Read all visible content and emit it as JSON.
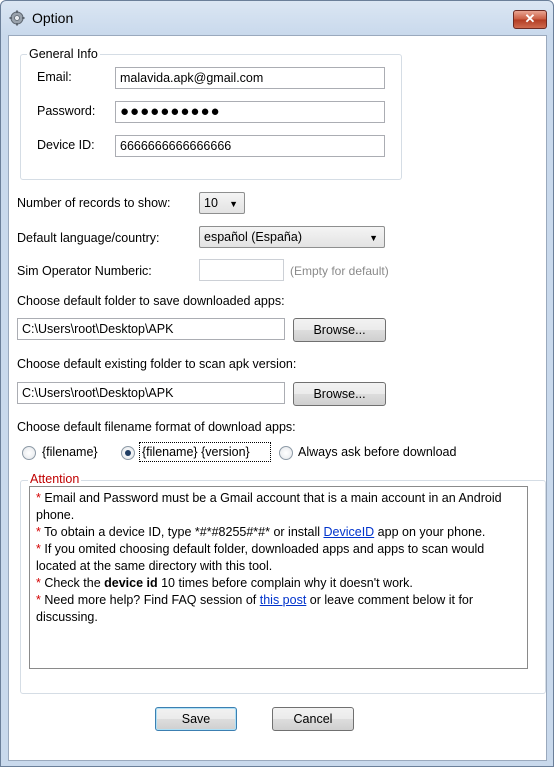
{
  "window": {
    "title": "Option",
    "close_label": "✕"
  },
  "general_info": {
    "legend": "General Info",
    "email_label": "Email:",
    "email_value": "malavida.apk@gmail.com",
    "password_label": "Password:",
    "password_value": "●●●●●●●●●●",
    "device_id_label": "Device ID:",
    "device_id_value": "6666666666666666"
  },
  "records": {
    "label": "Number of records  to show:",
    "value": "10",
    "arrow": "▼"
  },
  "language": {
    "label": "Default language/country:",
    "value": "español (España)",
    "arrow": "▼"
  },
  "sim": {
    "label": "Sim Operator Numberic:",
    "value": "",
    "hint": "(Empty for default)"
  },
  "download_folder": {
    "label": "Choose default folder to save downloaded apps:",
    "value": "C:\\Users\\root\\Desktop\\APK",
    "browse_label": "Browse..."
  },
  "scan_folder": {
    "label": "Choose default existing folder to scan apk version:",
    "value": "C:\\Users\\root\\Desktop\\APK",
    "browse_label": "Browse..."
  },
  "filename_format": {
    "label": "Choose default filename format of download apps:",
    "options": [
      {
        "label": "{filename}",
        "checked": false
      },
      {
        "label": "{filename} {version}",
        "checked": true
      },
      {
        "label": "Always ask before download",
        "checked": false
      }
    ]
  },
  "attention": {
    "legend": "Attention",
    "star": "*",
    "line1": "Email and Password must be a Gmail account that is a main account in an Android phone.",
    "line2_a": "To obtain a device ID, type *#*#8255#*#* or install ",
    "line2_link": "DeviceID",
    "line2_b": " app on your phone.",
    "line3": "If you omited choosing default folder, downloaded apps and apps to scan would located at the same directory with this tool.",
    "line4_a": "Check the ",
    "line4_bold": "device id",
    "line4_b": " 10 times before complain why it doesn't work.",
    "line5_a": "Need more help? Find FAQ session of ",
    "line5_link": "this post",
    "line5_b": " or leave comment below it for discussing."
  },
  "footer": {
    "save_label": "Save",
    "cancel_label": "Cancel"
  },
  "colors": {
    "title_bar": "#c9d9ec",
    "attention_red": "#c00000",
    "link_blue": "#0033cc"
  }
}
